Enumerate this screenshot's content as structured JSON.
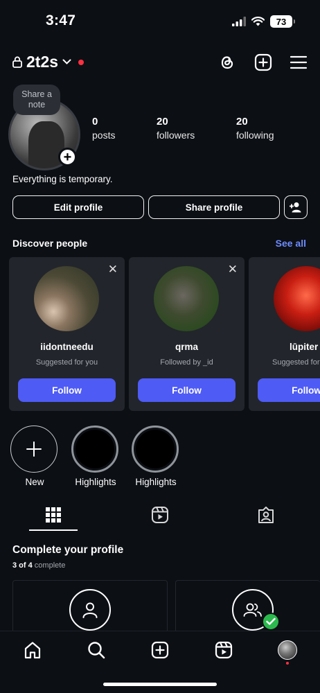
{
  "status": {
    "time": "3:47",
    "battery": "73"
  },
  "header": {
    "username": "2t2s"
  },
  "profile": {
    "note": "Share a note",
    "stats": [
      {
        "value": "0",
        "label": "posts"
      },
      {
        "value": "20",
        "label": "followers"
      },
      {
        "value": "20",
        "label": "following"
      }
    ],
    "bio": "Everything is temporary.",
    "edit_label": "Edit profile",
    "share_label": "Share profile"
  },
  "discover": {
    "title": "Discover people",
    "see_all": "See all",
    "close_glyph": "✕",
    "cards": [
      {
        "name": "iidontneedu",
        "subtitle": "Suggested for you",
        "follow": "Follow"
      },
      {
        "name": "qrma",
        "subtitle": "Followed by _id",
        "follow": "Follow"
      },
      {
        "name": "lūpiter",
        "subtitle": "Suggested for you",
        "follow": "Follow"
      }
    ]
  },
  "highlights": [
    {
      "label": "New"
    },
    {
      "label": "Highlights"
    },
    {
      "label": "Highlights"
    }
  ],
  "complete_profile": {
    "title": "Complete your profile",
    "progress_done": "3 of 4",
    "progress_word": "complete"
  },
  "icons": {
    "lock": "lock-icon",
    "threads": "threads-icon",
    "create": "plus-square-icon",
    "menu": "hamburger-menu-icon",
    "grid": "grid-icon",
    "reels": "reels-icon",
    "tagged": "tagged-icon",
    "home": "home-icon",
    "search": "search-icon",
    "profile": "profile-avatar-icon"
  },
  "colors": {
    "accent": "#4e5bf5",
    "link": "#6d8cff",
    "notification": "#ff3040",
    "success": "#2bb94d",
    "background": "#0c0f14"
  }
}
